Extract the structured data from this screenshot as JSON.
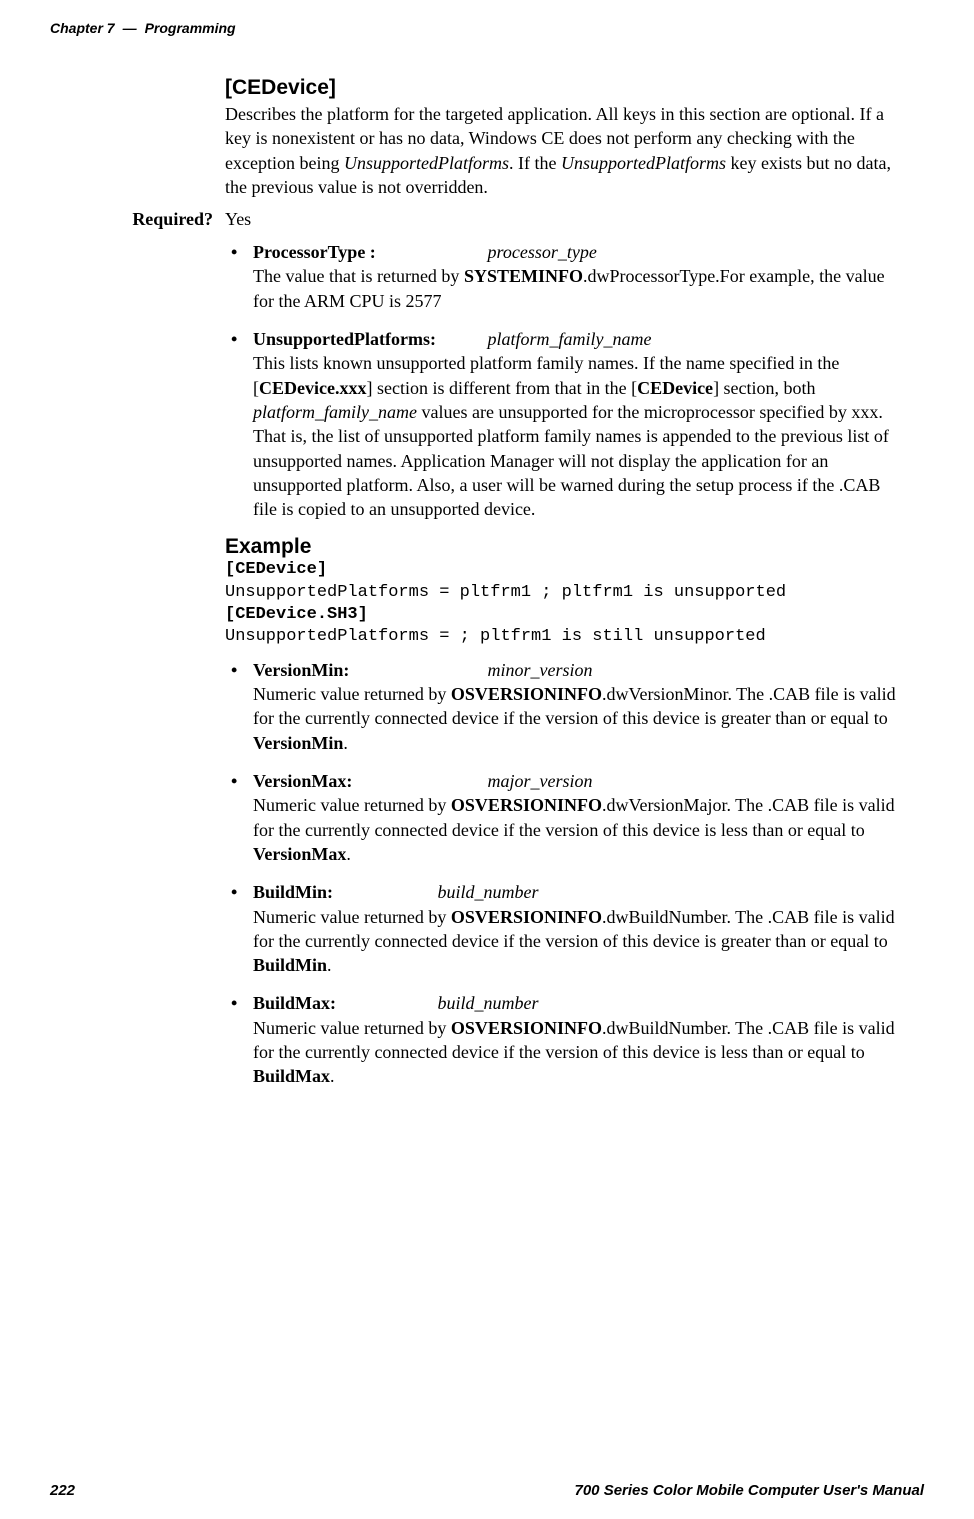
{
  "header": {
    "chapter": "Chapter 7",
    "separator": "—",
    "title": "Programming"
  },
  "cedevice": {
    "heading": "[CEDevice]",
    "desc_p1": "Describes the platform for the targeted application. All keys in this section are optional. If a key is nonexistent or has no data, Windows CE does not perform any checking with the exception being ",
    "desc_italic1": "UnsupportedPlatforms",
    "desc_p2": ". If the ",
    "desc_italic2": "UnsupportedPlatforms",
    "desc_p3": " key exists but no data, the previous value is not overridden."
  },
  "required": {
    "label": "Required?",
    "value": "Yes"
  },
  "items": {
    "processor_type": {
      "key": "ProcessorType  :",
      "val": "processor_type",
      "d1": "The value that is returned by ",
      "b1": "SYSTEMINFO",
      "d2": ".dwProcessorType.For example, the value for the ARM CPU is 2577"
    },
    "unsupported": {
      "key": "UnsupportedPlatforms:",
      "val": "platform_family_name",
      "d1": "This lists known unsupported platform family names. If the name specified in the [",
      "b1": "CEDevice.xxx",
      "d2": "] section is different from that in the [",
      "b2": "CEDevice",
      "d3": "] section, both ",
      "i1": "platform_family_name",
      "d4": " values are unsupported for the microprocessor specified by xxx. That is, the list of unsupported platform family names is appended to the previous list of unsupported names. Application Manager will not display the application for an unsupported platform. Also, a user will be warned during the setup process if the .CAB file is copied to an unsupported device."
    },
    "version_min": {
      "key": "VersionMin:",
      "val": "minor_version",
      "d1": "Numeric value returned by ",
      "b1": "OSVERSIONINFO",
      "d2": ".dwVersionMinor. The .CAB file is valid for the currently connected device if the version of this device is greater than or equal to ",
      "b2": "VersionMin",
      "d3": "."
    },
    "version_max": {
      "key": "VersionMax:",
      "val": "major_version",
      "d1": "Numeric value returned by ",
      "b1": "OSVERSIONINFO",
      "d2": ".dwVersionMajor. The .CAB file is valid for the currently connected device if the version of this device is less than or equal to ",
      "b2": "VersionMax",
      "d3": "."
    },
    "build_min": {
      "key": "BuildMin:",
      "val": "build_number",
      "d1": "Numeric value returned by ",
      "b1": "OSVERSIONINFO",
      "d2": ".dwBuildNumber. The .CAB file is valid for the currently connected device if the version of this device is greater than or equal to ",
      "b2": "BuildMin",
      "d3": "."
    },
    "build_max": {
      "key": "BuildMax:",
      "val": "build_number",
      "d1": "Numeric value returned by ",
      "b1": "OSVERSIONINFO",
      "d2": ".dwBuildNumber. The .CAB file is valid for the currently connected device if the version of this device is less than or equal to ",
      "b2": "BuildMax",
      "d3": "."
    }
  },
  "example": {
    "heading": "Example",
    "l1_bold": "[CEDevice]",
    "l2": "UnsupportedPlatforms = pltfrm1 ; pltfrm1 is unsupported",
    "l3_bold": "[CEDevice.SH3]",
    "l4": "UnsupportedPlatforms = ; pltfrm1 is still unsupported"
  },
  "footer": {
    "page": "222",
    "title": "700 Series Color Mobile Computer User's Manual"
  }
}
